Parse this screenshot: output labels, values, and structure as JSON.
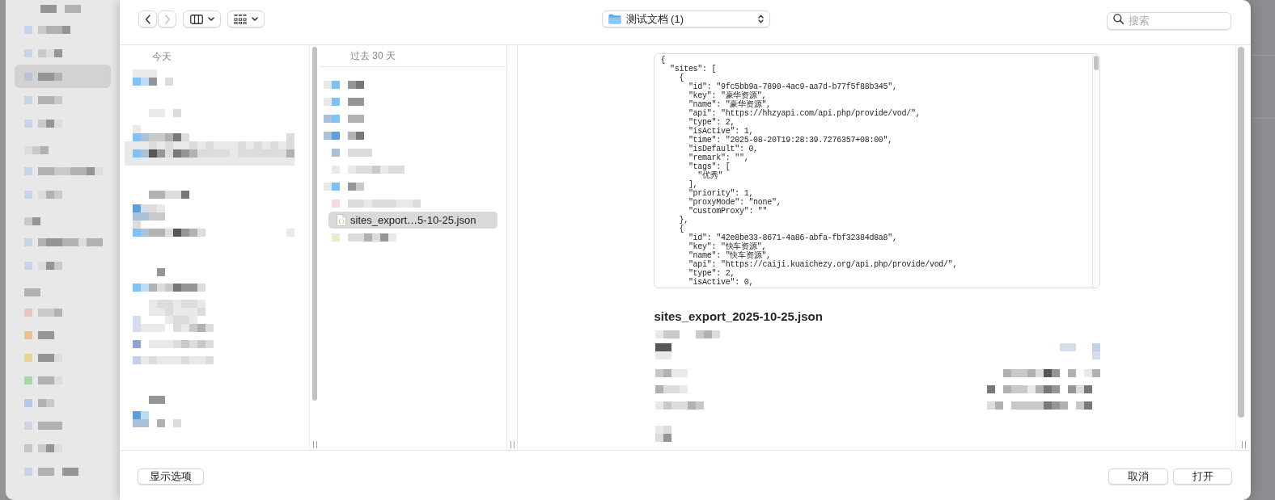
{
  "sidebar": {
    "items": [
      {
        "kind": "heading"
      },
      {
        "kind": "place",
        "selected": false
      },
      {
        "kind": "place",
        "selected": false
      },
      {
        "kind": "place",
        "selected": true
      },
      {
        "kind": "place",
        "selected": false
      },
      {
        "kind": "place",
        "selected": false
      },
      {
        "kind": "heading"
      },
      {
        "kind": "place",
        "selected": false
      },
      {
        "kind": "place",
        "selected": false
      },
      {
        "kind": "heading"
      },
      {
        "kind": "place",
        "selected": false
      },
      {
        "kind": "place",
        "selected": false
      },
      {
        "kind": "heading"
      },
      {
        "kind": "tag",
        "selected": false,
        "color": "#ebc3c3"
      },
      {
        "kind": "tag",
        "selected": false,
        "color": "#eac190"
      },
      {
        "kind": "tag",
        "selected": false,
        "color": "#e9d592"
      },
      {
        "kind": "tag",
        "selected": false,
        "color": "#a7d8a6"
      },
      {
        "kind": "tag",
        "selected": false,
        "color": "#b2c9ee"
      },
      {
        "kind": "tag",
        "selected": false,
        "color": "#dccfe4"
      },
      {
        "kind": "tag",
        "selected": false,
        "color": "#c5c5c5"
      },
      {
        "kind": "place",
        "selected": false
      }
    ]
  },
  "toolbar": {
    "back": {
      "disabled": false
    },
    "forward": {
      "disabled": true
    },
    "location": "测试文档 (1)",
    "search": {
      "placeholder": "搜索"
    }
  },
  "columns": [
    {
      "header": "今天"
    },
    {
      "header": "过去 30 天",
      "items": [
        {
          "kind": "pixelated",
          "selected": false
        },
        {
          "kind": "pixelated",
          "selected": false
        },
        {
          "kind": "pixelated",
          "selected": false
        },
        {
          "kind": "pixelated",
          "selected": false
        },
        {
          "kind": "pixelated",
          "selected": false
        },
        {
          "kind": "pixelated",
          "selected": false
        },
        {
          "kind": "pixelated",
          "selected": false
        },
        {
          "kind": "pixelated",
          "selected": false
        },
        {
          "kind": "file",
          "name": "sites_export…5-10-25.json",
          "selected": true
        },
        {
          "kind": "pixelated",
          "selected": false
        }
      ]
    }
  ],
  "preview": {
    "code": [
      "{",
      "  \"sites\": [",
      "    {",
      "      \"id\": \"9fc5bb9a-7890-4ac9-aa7d-b77f5f88b345\",",
      "      \"key\": \"豪华资源\",",
      "      \"name\": \"豪华资源\",",
      "      \"api\": \"https://hhzyapi.com/api.php/provide/vod/\",",
      "      \"type\": 2,",
      "      \"isActive\": 1,",
      "      \"time\": \"2025-08-20T19:28:39.7276357+08:00\",",
      "      \"isDefault\": 0,",
      "      \"remark\": \"\",",
      "      \"tags\": [",
      "        \"优秀\"",
      "      ],",
      "      \"priority\": 1,",
      "      \"proxyMode\": \"none\",",
      "      \"customProxy\": \"\"",
      "    },",
      "    {",
      "      \"id\": \"42e8be33-8671-4a86-abfa-fbf32384d8a8\",",
      "      \"key\": \"快车资源\",",
      "      \"name\": \"快车资源\",",
      "      \"api\": \"https://caiji.kuaichezy.org/api.php/provide/vod/\",",
      "      \"type\": 2,",
      "      \"isActive\": 0,"
    ],
    "file_name": "sites_export_2025-10-25.json"
  },
  "footer": {
    "left_button": "显示选项",
    "right_buttons": [
      "取消",
      "打开"
    ]
  }
}
